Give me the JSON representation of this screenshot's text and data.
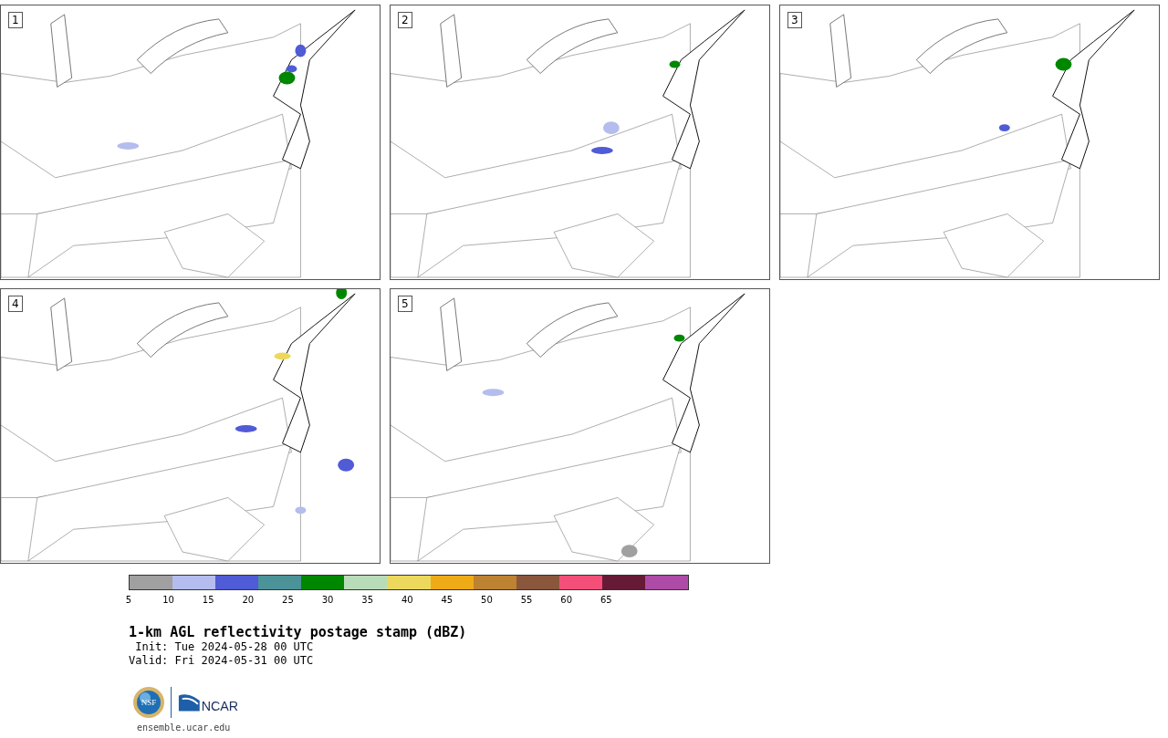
{
  "panels": [
    {
      "label": "1",
      "kind": "picture"
    },
    {
      "label": "2",
      "kind": "picture"
    },
    {
      "label": "3",
      "kind": "picture"
    },
    {
      "label": "4",
      "kind": "picture"
    },
    {
      "label": "5",
      "kind": "picture"
    }
  ],
  "colorbar": {
    "segments": [
      {
        "color": "#a0a0a0"
      },
      {
        "color": "#b4bded"
      },
      {
        "color": "#505bd6"
      },
      {
        "color": "#4b9399"
      },
      {
        "color": "#008700"
      },
      {
        "color": "#b8dbb8"
      },
      {
        "color": "#ecd85c"
      },
      {
        "color": "#eeaa17"
      },
      {
        "color": "#bd8232"
      },
      {
        "color": "#8a573c"
      },
      {
        "color": "#f44f78"
      },
      {
        "color": "#661a35"
      },
      {
        "color": "#ae4ba6"
      }
    ],
    "ticks": [
      "5",
      "10",
      "15",
      "20",
      "25",
      "30",
      "35",
      "40",
      "45",
      "50",
      "55",
      "60",
      "65"
    ]
  },
  "title": "1-km AGL reflectivity postage stamp (dBZ)",
  "init": " Init: Tue 2024-05-28 00 UTC",
  "valid": "Valid: Fri 2024-05-31 00 UTC",
  "logos": {
    "nsf": "NSF",
    "ncar": "NCAR"
  },
  "url": "ensemble.ucar.edu"
}
